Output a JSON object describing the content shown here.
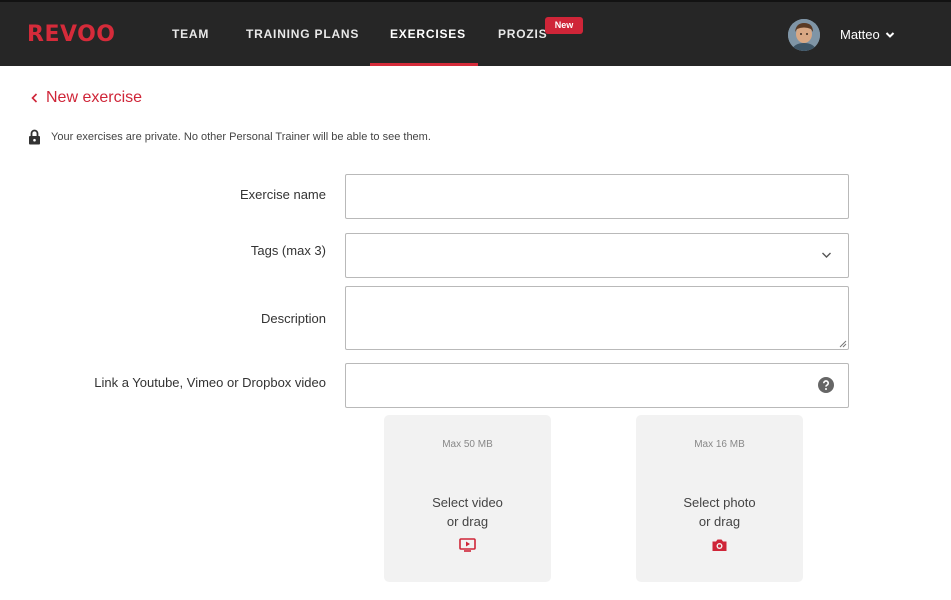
{
  "navbar": {
    "logo": "REVOO",
    "items": [
      {
        "label": "TEAM"
      },
      {
        "label": "TRAINING PLANS"
      },
      {
        "label": "EXERCISES"
      },
      {
        "label": "PROZIS"
      }
    ],
    "new_badge": "New",
    "user_name": "Matteo",
    "active_item": "EXERCISES"
  },
  "page": {
    "back_label": "New exercise",
    "privacy_note": "Your exercises are private. No other Personal Trainer will be able to see them."
  },
  "form": {
    "exercise_name": {
      "label": "Exercise name",
      "value": ""
    },
    "tags": {
      "label": "Tags (max 3)",
      "value": ""
    },
    "description": {
      "label": "Description",
      "value": ""
    },
    "video_link": {
      "label": "Link a Youtube, Vimeo or Dropbox video",
      "value": ""
    }
  },
  "uploads": {
    "video": {
      "max": "Max 50 MB",
      "line1": "Select video",
      "line2": "or drag",
      "icon": "video-play-icon"
    },
    "photo": {
      "max": "Max 16 MB",
      "line1": "Select photo",
      "line2": "or drag",
      "icon": "camera-icon"
    }
  },
  "colors": {
    "brand": "#d52b3a",
    "navbar_bg": "#262626",
    "upload_bg": "#f2f2f2"
  }
}
